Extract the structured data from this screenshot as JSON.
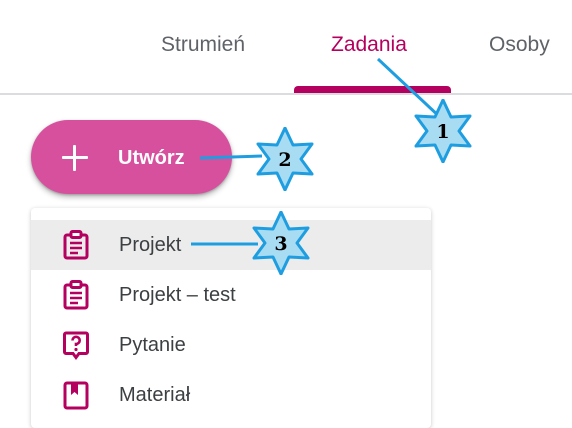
{
  "tabs": [
    {
      "label": "Strumień",
      "active": false
    },
    {
      "label": "Zadania",
      "active": true
    },
    {
      "label": "Osoby",
      "active": false
    }
  ],
  "create_button": {
    "label": "Utwórz",
    "icon": "plus-icon"
  },
  "menu": {
    "items": [
      {
        "label": "Projekt",
        "icon": "assignment-icon",
        "highlighted": true
      },
      {
        "label": "Projekt – test",
        "icon": "assignment-icon",
        "highlighted": false
      },
      {
        "label": "Pytanie",
        "icon": "question-icon",
        "highlighted": false
      },
      {
        "label": "Materiał",
        "icon": "material-bookmark-icon",
        "highlighted": false
      }
    ]
  },
  "callouts": [
    {
      "number": "1",
      "target": "tab-zadania"
    },
    {
      "number": "2",
      "target": "create-button"
    },
    {
      "number": "3",
      "target": "menu-item-projekt"
    }
  ],
  "colors": {
    "accent": "#b4005f",
    "button": "#d6509e",
    "tab_inactive": "#5f6368",
    "text": "#3c4043",
    "highlight_row": "#ececec",
    "callout_fill": "#a8dcf2",
    "callout_stroke": "#1e9ee0"
  }
}
